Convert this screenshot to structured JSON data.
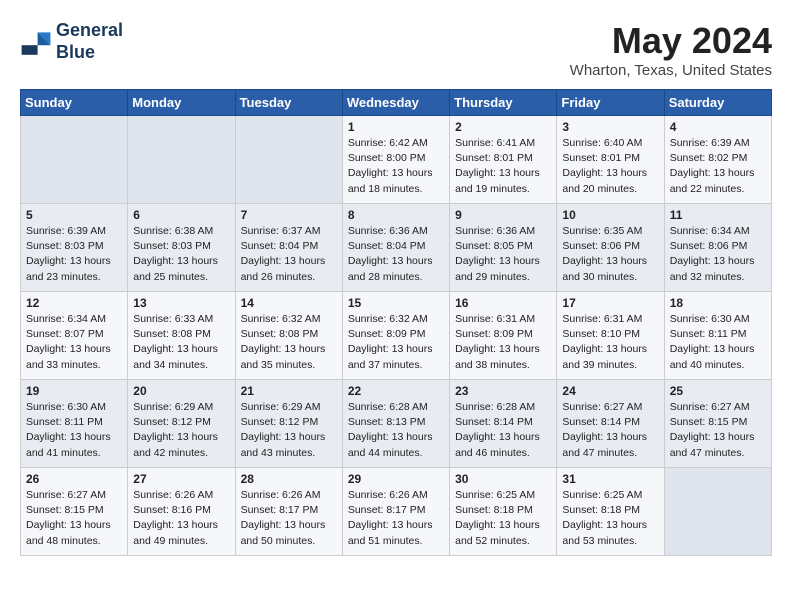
{
  "logo": {
    "line1": "General",
    "line2": "Blue"
  },
  "title": "May 2024",
  "location": "Wharton, Texas, United States",
  "headers": [
    "Sunday",
    "Monday",
    "Tuesday",
    "Wednesday",
    "Thursday",
    "Friday",
    "Saturday"
  ],
  "weeks": [
    [
      {
        "day": "",
        "info": ""
      },
      {
        "day": "",
        "info": ""
      },
      {
        "day": "",
        "info": ""
      },
      {
        "day": "1",
        "info": "Sunrise: 6:42 AM\nSunset: 8:00 PM\nDaylight: 13 hours\nand 18 minutes."
      },
      {
        "day": "2",
        "info": "Sunrise: 6:41 AM\nSunset: 8:01 PM\nDaylight: 13 hours\nand 19 minutes."
      },
      {
        "day": "3",
        "info": "Sunrise: 6:40 AM\nSunset: 8:01 PM\nDaylight: 13 hours\nand 20 minutes."
      },
      {
        "day": "4",
        "info": "Sunrise: 6:39 AM\nSunset: 8:02 PM\nDaylight: 13 hours\nand 22 minutes."
      }
    ],
    [
      {
        "day": "5",
        "info": "Sunrise: 6:39 AM\nSunset: 8:03 PM\nDaylight: 13 hours\nand 23 minutes."
      },
      {
        "day": "6",
        "info": "Sunrise: 6:38 AM\nSunset: 8:03 PM\nDaylight: 13 hours\nand 25 minutes."
      },
      {
        "day": "7",
        "info": "Sunrise: 6:37 AM\nSunset: 8:04 PM\nDaylight: 13 hours\nand 26 minutes."
      },
      {
        "day": "8",
        "info": "Sunrise: 6:36 AM\nSunset: 8:04 PM\nDaylight: 13 hours\nand 28 minutes."
      },
      {
        "day": "9",
        "info": "Sunrise: 6:36 AM\nSunset: 8:05 PM\nDaylight: 13 hours\nand 29 minutes."
      },
      {
        "day": "10",
        "info": "Sunrise: 6:35 AM\nSunset: 8:06 PM\nDaylight: 13 hours\nand 30 minutes."
      },
      {
        "day": "11",
        "info": "Sunrise: 6:34 AM\nSunset: 8:06 PM\nDaylight: 13 hours\nand 32 minutes."
      }
    ],
    [
      {
        "day": "12",
        "info": "Sunrise: 6:34 AM\nSunset: 8:07 PM\nDaylight: 13 hours\nand 33 minutes."
      },
      {
        "day": "13",
        "info": "Sunrise: 6:33 AM\nSunset: 8:08 PM\nDaylight: 13 hours\nand 34 minutes."
      },
      {
        "day": "14",
        "info": "Sunrise: 6:32 AM\nSunset: 8:08 PM\nDaylight: 13 hours\nand 35 minutes."
      },
      {
        "day": "15",
        "info": "Sunrise: 6:32 AM\nSunset: 8:09 PM\nDaylight: 13 hours\nand 37 minutes."
      },
      {
        "day": "16",
        "info": "Sunrise: 6:31 AM\nSunset: 8:09 PM\nDaylight: 13 hours\nand 38 minutes."
      },
      {
        "day": "17",
        "info": "Sunrise: 6:31 AM\nSunset: 8:10 PM\nDaylight: 13 hours\nand 39 minutes."
      },
      {
        "day": "18",
        "info": "Sunrise: 6:30 AM\nSunset: 8:11 PM\nDaylight: 13 hours\nand 40 minutes."
      }
    ],
    [
      {
        "day": "19",
        "info": "Sunrise: 6:30 AM\nSunset: 8:11 PM\nDaylight: 13 hours\nand 41 minutes."
      },
      {
        "day": "20",
        "info": "Sunrise: 6:29 AM\nSunset: 8:12 PM\nDaylight: 13 hours\nand 42 minutes."
      },
      {
        "day": "21",
        "info": "Sunrise: 6:29 AM\nSunset: 8:12 PM\nDaylight: 13 hours\nand 43 minutes."
      },
      {
        "day": "22",
        "info": "Sunrise: 6:28 AM\nSunset: 8:13 PM\nDaylight: 13 hours\nand 44 minutes."
      },
      {
        "day": "23",
        "info": "Sunrise: 6:28 AM\nSunset: 8:14 PM\nDaylight: 13 hours\nand 46 minutes."
      },
      {
        "day": "24",
        "info": "Sunrise: 6:27 AM\nSunset: 8:14 PM\nDaylight: 13 hours\nand 47 minutes."
      },
      {
        "day": "25",
        "info": "Sunrise: 6:27 AM\nSunset: 8:15 PM\nDaylight: 13 hours\nand 47 minutes."
      }
    ],
    [
      {
        "day": "26",
        "info": "Sunrise: 6:27 AM\nSunset: 8:15 PM\nDaylight: 13 hours\nand 48 minutes."
      },
      {
        "day": "27",
        "info": "Sunrise: 6:26 AM\nSunset: 8:16 PM\nDaylight: 13 hours\nand 49 minutes."
      },
      {
        "day": "28",
        "info": "Sunrise: 6:26 AM\nSunset: 8:17 PM\nDaylight: 13 hours\nand 50 minutes."
      },
      {
        "day": "29",
        "info": "Sunrise: 6:26 AM\nSunset: 8:17 PM\nDaylight: 13 hours\nand 51 minutes."
      },
      {
        "day": "30",
        "info": "Sunrise: 6:25 AM\nSunset: 8:18 PM\nDaylight: 13 hours\nand 52 minutes."
      },
      {
        "day": "31",
        "info": "Sunrise: 6:25 AM\nSunset: 8:18 PM\nDaylight: 13 hours\nand 53 minutes."
      },
      {
        "day": "",
        "info": ""
      }
    ]
  ]
}
